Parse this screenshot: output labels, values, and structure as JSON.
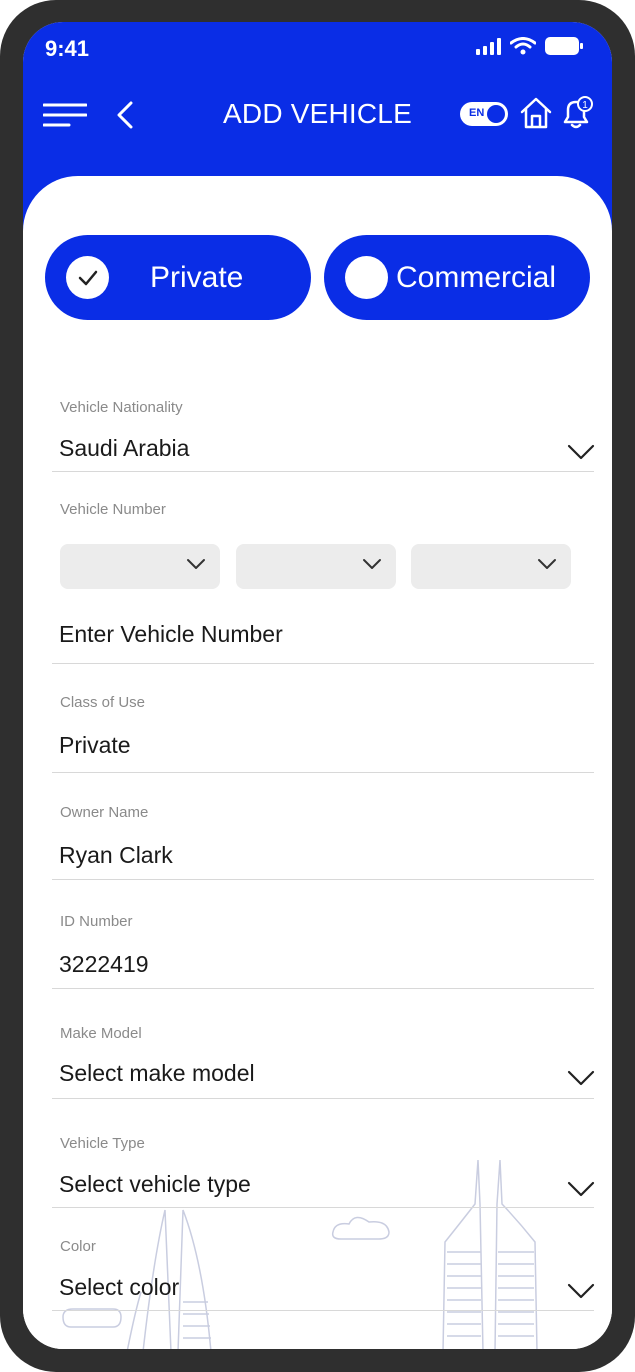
{
  "status_bar": {
    "time": "9:41"
  },
  "header": {
    "title": "ADD VEHICLE",
    "language_toggle": "EN"
  },
  "vehicle_category": {
    "options": [
      {
        "label": "Private",
        "selected": true
      },
      {
        "label": "Commercial",
        "selected": false
      }
    ]
  },
  "form": {
    "vehicle_nationality": {
      "label": "Vehicle Nationality",
      "value": "Saudi Arabia"
    },
    "vehicle_number": {
      "label": "Vehicle Number",
      "placeholder": "Enter Vehicle Number"
    },
    "class_of_use": {
      "label": "Class of Use",
      "value": "Private"
    },
    "owner_name": {
      "label": "Owner Name",
      "value": "Ryan Clark"
    },
    "id_number": {
      "label": "ID Number",
      "value": "3222419"
    },
    "make_model": {
      "label": "Make Model",
      "placeholder": "Select make model"
    },
    "vehicle_type": {
      "label": "Vehicle Type",
      "placeholder": "Select vehicle type"
    },
    "color": {
      "label": "Color",
      "placeholder": "Select color"
    }
  },
  "colors": {
    "primary": "#0a2de6",
    "frame": "#2f2f2f",
    "label": "#8a8a8a",
    "input_bg": "#ececec"
  }
}
